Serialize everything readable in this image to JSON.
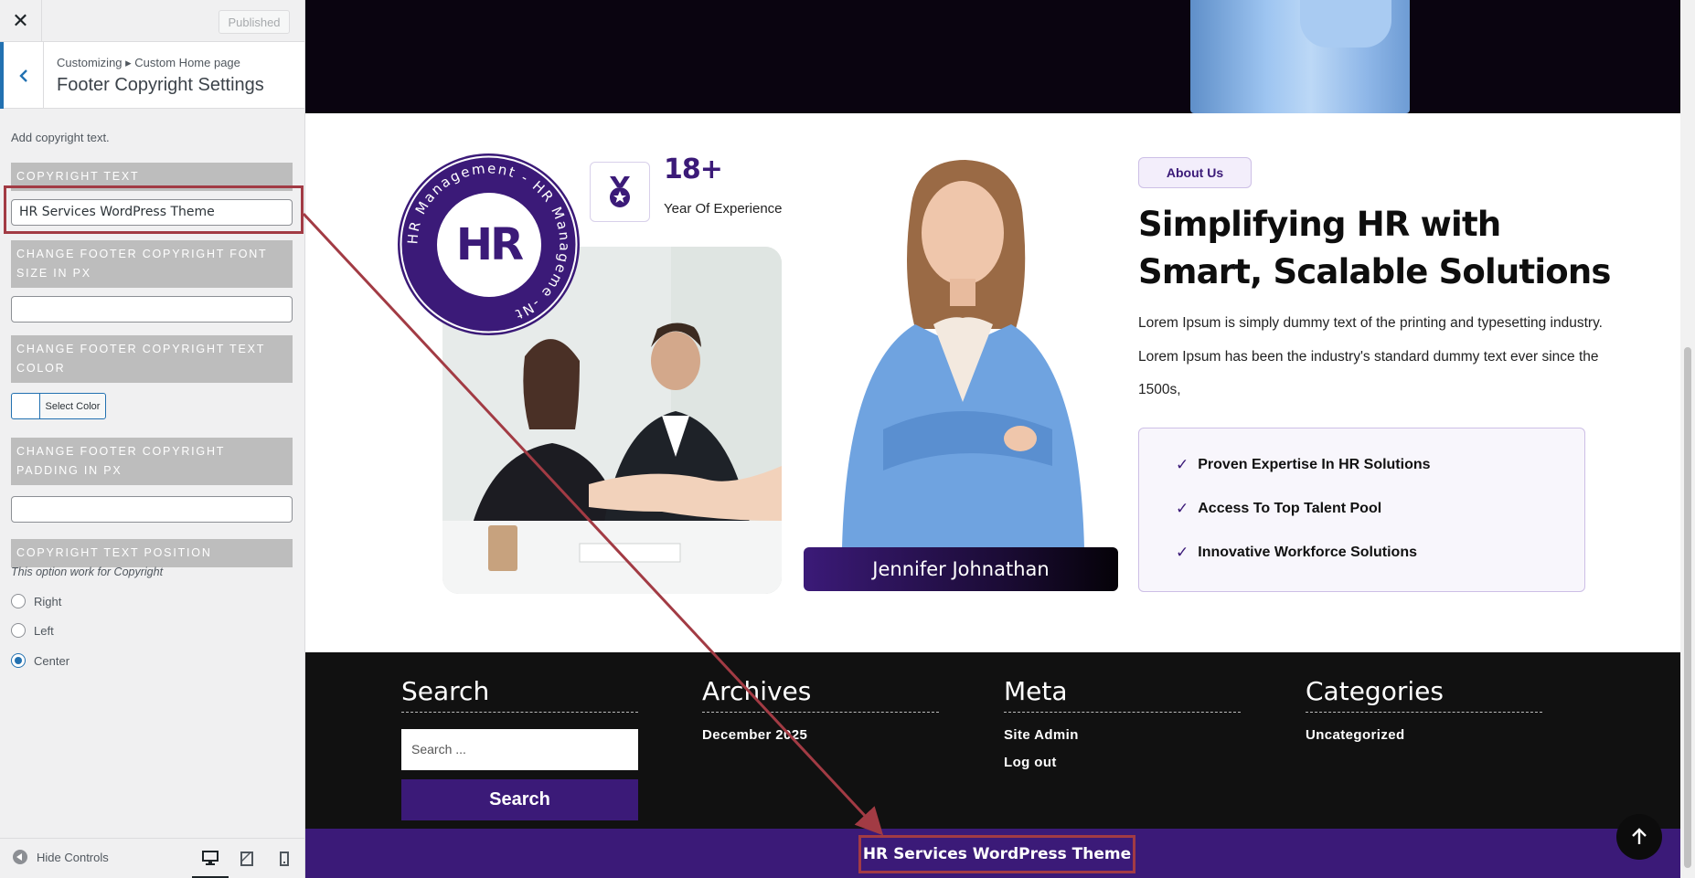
{
  "customizer": {
    "close_label": "✕",
    "publish_button": "Published",
    "breadcrumb": "Customizing ▸ Custom Home page",
    "section_title": "Footer Copyright Settings",
    "description": "Add copyright text.",
    "controls": {
      "copyright_text_label": "Copyright Text",
      "copyright_text_value": "HR Services WordPress Theme",
      "font_size_label": "Change Footer Copyright Font Size in PX",
      "font_size_value": "",
      "text_color_label": "Change Footer Copyright Text Color",
      "select_color_label": "Select Color",
      "padding_label": "Change Footer Copyright Padding in PX",
      "padding_value": "",
      "position_label": "Copyright Text Position",
      "position_note": "This option work for Copyright",
      "position_options": [
        "Right",
        "Left",
        "Center"
      ],
      "position_selected": "Center"
    },
    "footer": {
      "hide_controls": "Hide Controls",
      "devices": [
        "desktop-icon",
        "tablet-icon",
        "mobile-icon"
      ],
      "active_device": "desktop"
    }
  },
  "preview": {
    "experience": {
      "number": "18+",
      "label": "Year Of Experience"
    },
    "seal": {
      "letters": "HR",
      "ring_text": "HR Management - HR Manageme -Nt"
    },
    "person_name": "Jennifer Johnathan",
    "about": {
      "badge": "About Us",
      "title": "Simplifying HR with Smart, Scalable Solutions",
      "text": "Lorem Ipsum is simply dummy text of the printing and typesetting industry. Lorem Ipsum has been the industry's standard dummy text ever since the 1500s,",
      "features": [
        "Proven Expertise In HR Solutions",
        "Access To Top Talent Pool",
        "Innovative Workforce Solutions"
      ]
    },
    "footer_widgets": {
      "search": {
        "title": "Search",
        "placeholder": "Search ...",
        "button": "Search"
      },
      "archives": {
        "title": "Archives",
        "links": [
          "December 2025"
        ]
      },
      "meta": {
        "title": "Meta",
        "links": [
          "Site Admin",
          "Log out"
        ]
      },
      "categories": {
        "title": "Categories",
        "links": [
          "Uncategorized"
        ]
      }
    },
    "copyright": "HR Services WordPress Theme"
  },
  "colors": {
    "brand_purple": "#3b1a78",
    "highlight_red": "#a23b44",
    "wp_blue": "#2271b1"
  }
}
